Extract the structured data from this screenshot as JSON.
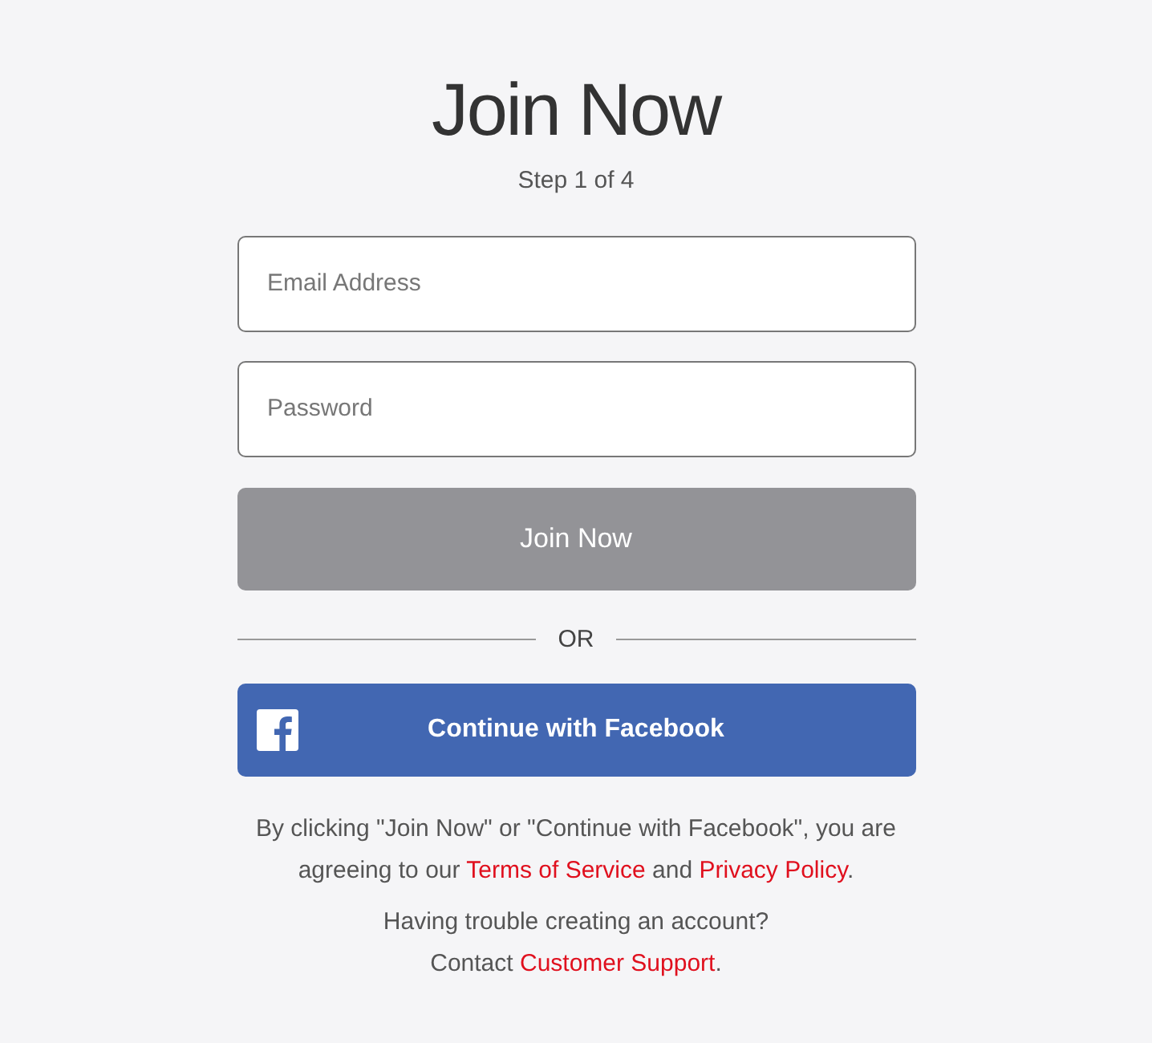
{
  "title": "Join Now",
  "step": "Step 1 of 4",
  "fields": [
    {
      "placeholder": "Email Address"
    },
    {
      "placeholder": "Password"
    }
  ],
  "submit": {
    "label": "Join Now",
    "disabled": true
  },
  "divider": "OR",
  "facebook": {
    "label": "Continue with Facebook"
  },
  "consent": [
    {
      "kind": "text",
      "text": "By clicking \"Join Now\" or \"Continue with Facebook\", you are agreeing to our "
    },
    {
      "kind": "link",
      "text": "Terms of Service"
    },
    {
      "kind": "text",
      "text": " and "
    },
    {
      "kind": "link",
      "text": "Privacy Policy"
    },
    {
      "kind": "text",
      "text": "."
    }
  ],
  "help": [
    {
      "kind": "text",
      "text": "Having trouble creating an account?"
    },
    {
      "kind": "break"
    },
    {
      "kind": "text",
      "text": "Contact "
    },
    {
      "kind": "link",
      "text": "Customer Support"
    },
    {
      "kind": "text",
      "text": "."
    }
  ]
}
